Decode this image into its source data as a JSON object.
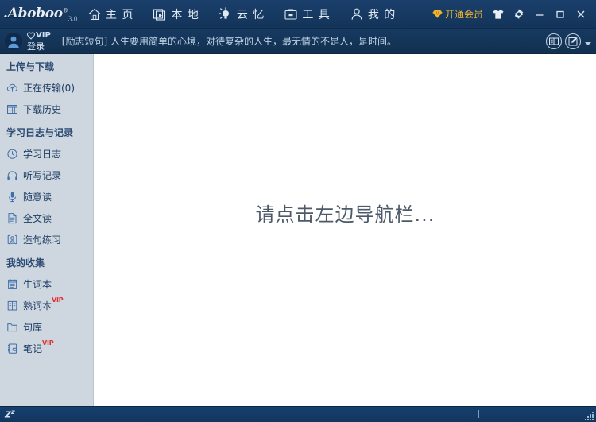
{
  "app": {
    "logo_text": ".Aboboo",
    "logo_reg": "®",
    "logo_version": "3.0"
  },
  "nav": {
    "items": [
      {
        "label": "主 页",
        "icon": "home-icon",
        "active": false
      },
      {
        "label": "本 地",
        "icon": "video-library-icon",
        "active": false
      },
      {
        "label": "云 忆",
        "icon": "lightbulb-icon",
        "active": false
      },
      {
        "label": "工 具",
        "icon": "toolbox-icon",
        "active": false
      },
      {
        "label": "我 的",
        "icon": "person-icon",
        "active": true
      }
    ]
  },
  "titlebar": {
    "vip_label": "开通会员",
    "shirt_icon": "tshirt-icon",
    "gear_icon": "gear-icon",
    "minimize": "−",
    "maximize": "□",
    "close": "✕"
  },
  "subbar": {
    "avatar": "user-avatar-icon",
    "vip_label": "VIP",
    "login_label": "登录",
    "quote": "[励志短句] 人生要用简单的心境，对待复杂的人生，最无情的不是人，是时间。",
    "dictionary_icon": "dictionary-icon",
    "note_icon": "edit-note-icon"
  },
  "sidebar": {
    "groups": [
      {
        "title": "上传与下载",
        "items": [
          {
            "label": "正在传输(0)",
            "icon": "cloud-upload-icon",
            "vip": false
          },
          {
            "label": "下载历史",
            "icon": "history-grid-icon",
            "vip": false
          }
        ]
      },
      {
        "title": "学习日志与记录",
        "items": [
          {
            "label": "学习日志",
            "icon": "clock-icon",
            "vip": false
          },
          {
            "label": "听写记录",
            "icon": "headphones-icon",
            "vip": false
          },
          {
            "label": "随意读",
            "icon": "microphone-icon",
            "vip": false
          },
          {
            "label": "全文读",
            "icon": "document-icon",
            "vip": false
          },
          {
            "label": "造句练习",
            "icon": "sentence-practice-icon",
            "vip": false
          }
        ]
      },
      {
        "title": "我的收集",
        "items": [
          {
            "label": "生词本",
            "icon": "notebook-icon",
            "vip": false
          },
          {
            "label": "熟词本",
            "icon": "known-words-icon",
            "vip": true
          },
          {
            "label": "句库",
            "icon": "folder-icon",
            "vip": false
          },
          {
            "label": "笔记",
            "icon": "notes-icon",
            "vip": true
          }
        ]
      }
    ],
    "vip_badge": "VIP"
  },
  "content": {
    "hint": "请点击左边导航栏..."
  },
  "statusbar": {
    "sleep_label": "Z",
    "sleep_sup": "z"
  },
  "colors": {
    "titlebar_bg": "#173a63",
    "sidebar_bg": "#ced6e0",
    "content_bg": "#ffffff",
    "accent_gold": "#f2b632",
    "vip_red": "#e03030",
    "sidebar_text": "#1d3d63"
  }
}
